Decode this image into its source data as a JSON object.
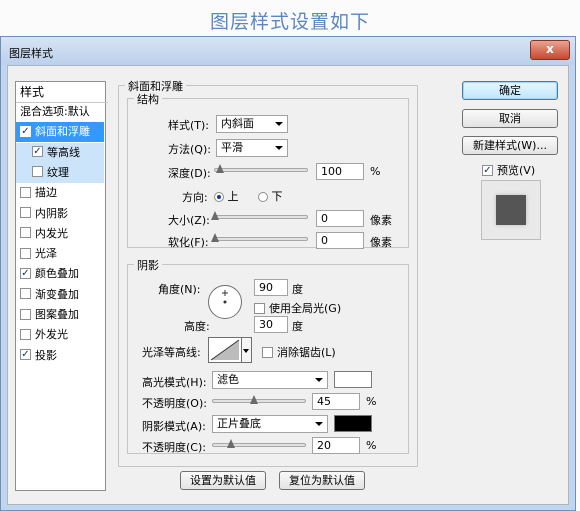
{
  "banner": {
    "title": "图层样式设置如下"
  },
  "dialog": {
    "title": "图层样式",
    "close_label": "x"
  },
  "style_list": {
    "header": "样式",
    "items": [
      {
        "label": "混合选项:默认",
        "checkable": false,
        "checked": false
      },
      {
        "label": "斜面和浮雕",
        "checkable": true,
        "checked": true,
        "selected": true
      },
      {
        "label": "等高线",
        "checkable": true,
        "checked": true,
        "sub": true
      },
      {
        "label": "纹理",
        "checkable": true,
        "checked": false,
        "sub": true
      },
      {
        "label": "描边",
        "checkable": true,
        "checked": false
      },
      {
        "label": "内阴影",
        "checkable": true,
        "checked": false
      },
      {
        "label": "内发光",
        "checkable": true,
        "checked": false
      },
      {
        "label": "光泽",
        "checkable": true,
        "checked": false
      },
      {
        "label": "颜色叠加",
        "checkable": true,
        "checked": true
      },
      {
        "label": "渐变叠加",
        "checkable": true,
        "checked": false
      },
      {
        "label": "图案叠加",
        "checkable": true,
        "checked": false
      },
      {
        "label": "外发光",
        "checkable": true,
        "checked": false
      },
      {
        "label": "投影",
        "checkable": true,
        "checked": true
      }
    ]
  },
  "bevel": {
    "section_title": "斜面和浮雕",
    "structure": {
      "title": "结构",
      "style_label": "样式(T):",
      "style_value": "内斜面",
      "method_label": "方法(Q):",
      "method_value": "平滑",
      "depth_label": "深度(D):",
      "depth_value": "100",
      "depth_unit": "%",
      "depth_fraction": 0.05,
      "direction_label": "方向:",
      "dir_up": "上",
      "dir_down": "下",
      "dir_selected": "上",
      "size_label": "大小(Z):",
      "size_value": "0",
      "size_unit": "像素",
      "size_fraction": 0.0,
      "soften_label": "软化(F):",
      "soften_value": "0",
      "soften_unit": "像素",
      "soften_fraction": 0.0
    },
    "shading": {
      "title": "阴影",
      "angle_label": "角度(N):",
      "angle_value": "90",
      "angle_unit": "度",
      "global_light_label": "使用全局光(G)",
      "global_light_checked": false,
      "altitude_label": "高度:",
      "altitude_value": "30",
      "altitude_unit": "度",
      "gloss_label": "光泽等高线:",
      "antialias_label": "消除锯齿(L)",
      "antialias_checked": false,
      "highlight_mode_label": "高光模式(H):",
      "highlight_mode_value": "滤色",
      "highlight_color": "#ffffff",
      "highlight_opacity_label": "不透明度(O):",
      "highlight_opacity_value": "45",
      "highlight_opacity_unit": "%",
      "highlight_opacity_fraction": 0.45,
      "shadow_mode_label": "阴影模式(A):",
      "shadow_mode_value": "正片叠底",
      "shadow_color": "#000000",
      "shadow_opacity_label": "不透明度(C):",
      "shadow_opacity_value": "20",
      "shadow_opacity_unit": "%",
      "shadow_opacity_fraction": 0.2
    },
    "set_default_label": "设置为默认值",
    "reset_default_label": "复位为默认值"
  },
  "actions": {
    "ok_label": "确定",
    "cancel_label": "取消",
    "new_style_label": "新建样式(W)...",
    "preview_label": "预览(V)",
    "preview_checked": true
  },
  "colors": {
    "accent": "#3399ff",
    "dialog_frame": "#c2d5ee",
    "banner_text": "#5b86c5"
  }
}
